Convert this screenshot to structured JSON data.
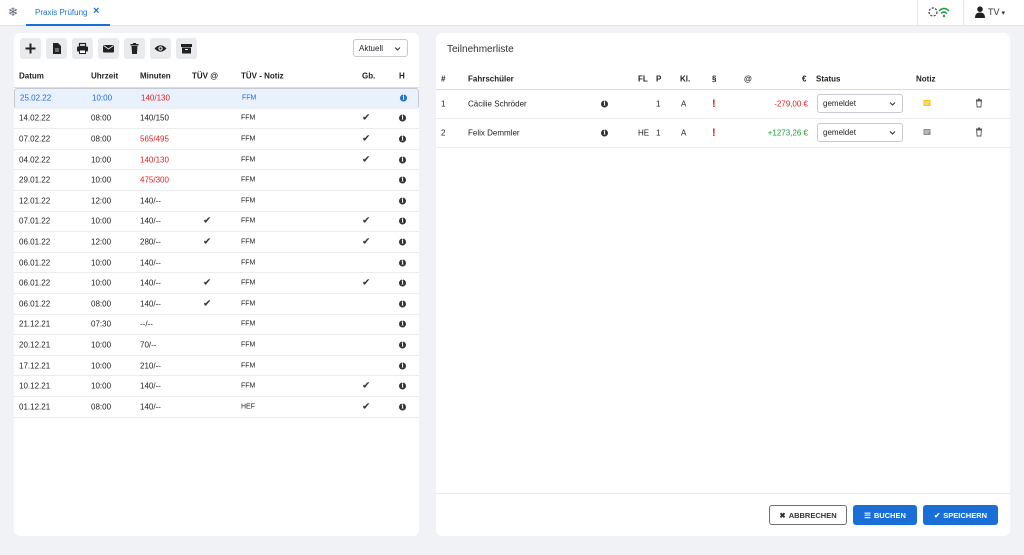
{
  "topbar": {
    "tab_label": "Praxis Prüfung",
    "user_label": "TV"
  },
  "left": {
    "filter": {
      "value": "Aktuell"
    },
    "headers": {
      "date": "Datum",
      "time": "Uhrzeit",
      "minutes": "Minuten",
      "tuev_at": "TÜV @",
      "tuev_note": "TÜV - Notiz",
      "gb": "Gb.",
      "h": "H"
    },
    "rows": [
      {
        "date": "25.02.22",
        "time": "10:00",
        "minutes": "140/130",
        "minutes_red": true,
        "tuev_at": false,
        "note": "FFM",
        "gb": false,
        "selected": true
      },
      {
        "date": "14.02.22",
        "time": "08:00",
        "minutes": "140/150",
        "minutes_red": false,
        "tuev_at": false,
        "note": "FFM",
        "gb": true,
        "selected": false
      },
      {
        "date": "07.02.22",
        "time": "08:00",
        "minutes": "565/495",
        "minutes_red": true,
        "tuev_at": false,
        "note": "FFM",
        "gb": true,
        "selected": false
      },
      {
        "date": "04.02.22",
        "time": "10:00",
        "minutes": "140/130",
        "minutes_red": true,
        "tuev_at": false,
        "note": "FFM",
        "gb": true,
        "selected": false
      },
      {
        "date": "29.01.22",
        "time": "10:00",
        "minutes": "475/300",
        "minutes_red": true,
        "tuev_at": false,
        "note": "FFM",
        "gb": false,
        "selected": false
      },
      {
        "date": "12.01.22",
        "time": "12:00",
        "minutes": "140/--",
        "minutes_red": false,
        "tuev_at": false,
        "note": "FFM",
        "gb": false,
        "selected": false
      },
      {
        "date": "07.01.22",
        "time": "10:00",
        "minutes": "140/--",
        "minutes_red": false,
        "tuev_at": true,
        "note": "FFM",
        "gb": true,
        "selected": false
      },
      {
        "date": "06.01.22",
        "time": "12:00",
        "minutes": "280/--",
        "minutes_red": false,
        "tuev_at": true,
        "note": "FFM",
        "gb": true,
        "selected": false
      },
      {
        "date": "06.01.22",
        "time": "10:00",
        "minutes": "140/--",
        "minutes_red": false,
        "tuev_at": false,
        "note": "FFM",
        "gb": false,
        "selected": false
      },
      {
        "date": "06.01.22",
        "time": "10:00",
        "minutes": "140/--",
        "minutes_red": false,
        "tuev_at": true,
        "note": "FFM",
        "gb": true,
        "selected": false
      },
      {
        "date": "06.01.22",
        "time": "08:00",
        "minutes": "140/--",
        "minutes_red": false,
        "tuev_at": true,
        "note": "FFM",
        "gb": false,
        "selected": false
      },
      {
        "date": "21.12.21",
        "time": "07:30",
        "minutes": "--/--",
        "minutes_red": false,
        "tuev_at": false,
        "note": "FFM",
        "gb": false,
        "selected": false
      },
      {
        "date": "20.12.21",
        "time": "10:00",
        "minutes": "70/--",
        "minutes_red": false,
        "tuev_at": false,
        "note": "FFM",
        "gb": false,
        "selected": false
      },
      {
        "date": "17.12.21",
        "time": "10:00",
        "minutes": "210/--",
        "minutes_red": false,
        "tuev_at": false,
        "note": "FFM",
        "gb": false,
        "selected": false
      },
      {
        "date": "10.12.21",
        "time": "10:00",
        "minutes": "140/--",
        "minutes_red": false,
        "tuev_at": false,
        "note": "FFM",
        "gb": true,
        "selected": false
      },
      {
        "date": "01.12.21",
        "time": "08:00",
        "minutes": "140/--",
        "minutes_red": false,
        "tuev_at": false,
        "note": "HEF",
        "gb": true,
        "selected": false
      }
    ]
  },
  "right": {
    "title": "Teilnehmerliste",
    "headers": {
      "num": "#",
      "student": "Fahrschüler",
      "fl": "FL",
      "p": "P",
      "kl": "Kl.",
      "para": "§",
      "at": "@",
      "euro": "€",
      "status": "Status",
      "note": "Notiz"
    },
    "rows": [
      {
        "num": "1",
        "student": "Cäcilie Schröder",
        "fl": "",
        "p": "1",
        "kl": "A",
        "amount": "-279,00 €",
        "amount_color": "#e02020",
        "status": "gemeldet",
        "note_color": "#f5c518"
      },
      {
        "num": "2",
        "student": "Felix Demmler",
        "fl": "HE",
        "p": "1",
        "kl": "A",
        "amount": "+1273,26 €",
        "amount_color": "#1e9b3a",
        "status": "gemeldet",
        "note_color": "#8a8d94"
      }
    ],
    "buttons": {
      "cancel": "ABBRECHEN",
      "book": "BUCHEN",
      "save": "SPEICHERN"
    }
  },
  "colors": {
    "accent": "#1a6fd6",
    "negative": "#e02020",
    "positive": "#1e9b3a"
  },
  "icons": [
    "snowflake-icon",
    "close-icon",
    "wifi-icon",
    "user-icon",
    "add-icon",
    "document-icon",
    "print-icon",
    "mail-icon",
    "delete-icon",
    "view-icon",
    "archive-icon",
    "info-icon",
    "check-icon",
    "exclamation-icon",
    "note-icon",
    "trash-icon"
  ]
}
